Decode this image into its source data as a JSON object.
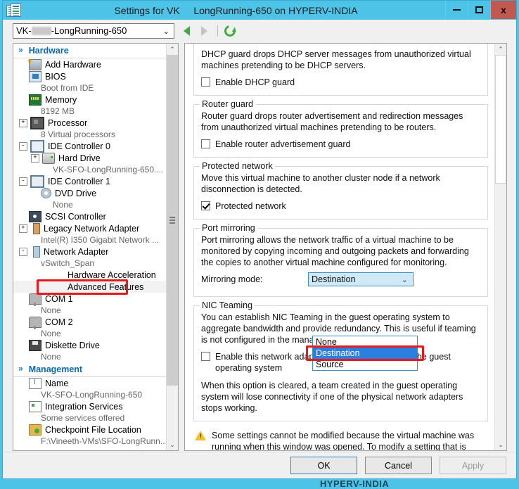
{
  "window": {
    "title_part1": "Settings for VK",
    "title_part2": "LongRunning-650 on HYPERV-INDIA",
    "icon": "settings-document-icon",
    "minimize_label": "",
    "maximize_label": "",
    "close_label": "x",
    "accent_color": "#4ec3e8",
    "close_color": "#c2584f"
  },
  "background": {
    "watermark": "HYPERV-INDIA"
  },
  "toolbar": {
    "vm_select_prefix": "VK-",
    "vm_select_suffix": "-LongRunning-650",
    "vm_select_caret": "⌄",
    "back_icon": "back-arrow-icon",
    "forward_icon": "forward-arrow-icon",
    "refresh_icon": "refresh-icon"
  },
  "sidebar": {
    "groups": [
      {
        "title": "Hardware",
        "chevron": "«",
        "items": [
          {
            "label": "Add Hardware",
            "sub": "",
            "expander": "",
            "icon": "add-hardware-icon",
            "indent": 0
          },
          {
            "label": "BIOS",
            "sub": "Boot from IDE",
            "expander": "",
            "icon": "bios-icon",
            "indent": 0
          },
          {
            "label": "Memory",
            "sub": "8192 MB",
            "expander": "",
            "icon": "memory-icon",
            "indent": 0
          },
          {
            "label": "Processor",
            "sub": "8 Virtual processors",
            "expander": "+",
            "icon": "processor-icon",
            "indent": 0
          },
          {
            "label": "IDE Controller 0",
            "sub": "",
            "expander": "-",
            "icon": "ide-controller-icon",
            "indent": 0
          },
          {
            "label": "Hard Drive",
            "sub": "VK-SFO-LongRunning-650....",
            "expander": "+",
            "icon": "hard-drive-icon",
            "indent": 1
          },
          {
            "label": "IDE Controller 1",
            "sub": "",
            "expander": "-",
            "icon": "ide-controller-icon",
            "indent": 0
          },
          {
            "label": "DVD Drive",
            "sub": "None",
            "expander": "",
            "icon": "dvd-drive-icon",
            "indent": 1
          },
          {
            "label": "SCSI Controller",
            "sub": "",
            "expander": "",
            "icon": "scsi-controller-icon",
            "indent": 0
          },
          {
            "label": "Legacy Network Adapter",
            "sub": "Intel(R) I350 Gigabit Network ...",
            "expander": "+",
            "icon": "legacy-network-adapter-icon",
            "indent": 0
          },
          {
            "label": "Network Adapter",
            "sub": "vSwitch_Span",
            "expander": "-",
            "icon": "network-adapter-icon",
            "indent": 0
          },
          {
            "label": "Hardware Acceleration",
            "sub": "",
            "expander": "",
            "icon": "",
            "indent": 2
          },
          {
            "label": "Advanced Features",
            "sub": "",
            "expander": "",
            "icon": "",
            "indent": 2,
            "selected": true,
            "annotated": true
          },
          {
            "label": "COM 1",
            "sub": "None",
            "expander": "",
            "icon": "com-port-icon",
            "indent": 0
          },
          {
            "label": "COM 2",
            "sub": "None",
            "expander": "",
            "icon": "com-port-icon",
            "indent": 0
          },
          {
            "label": "Diskette Drive",
            "sub": "None",
            "expander": "",
            "icon": "diskette-drive-icon",
            "indent": 0
          }
        ]
      },
      {
        "title": "Management",
        "chevron": "«",
        "items": [
          {
            "label": "Name",
            "sub": "VK-SFO-LongRunning-650",
            "expander": "",
            "icon": "name-icon",
            "indent": 0
          },
          {
            "label": "Integration Services",
            "sub": "Some services offered",
            "expander": "",
            "icon": "integration-services-icon",
            "indent": 0
          },
          {
            "label": "Checkpoint File Location",
            "sub": "F:\\Vineeth-VMs\\SFO-LongRunn...",
            "expander": "",
            "icon": "checkpoint-folder-icon",
            "indent": 0
          }
        ]
      }
    ],
    "scroll_up": "⌃",
    "scroll_down": "⌄"
  },
  "content": {
    "dhcp_guard": {
      "description": "DHCP guard drops DHCP server messages from unauthorized virtual machines pretending to be DHCP servers.",
      "checkbox_label": "Enable DHCP guard",
      "checked": false
    },
    "router_guard": {
      "legend": "Router guard",
      "description": "Router guard drops router advertisement and redirection messages from unauthorized virtual machines pretending to be routers.",
      "checkbox_label": "Enable router advertisement guard",
      "checked": false
    },
    "protected_network": {
      "legend": "Protected network",
      "description": "Move this virtual machine to another cluster node if a network disconnection is detected.",
      "checkbox_label": "Protected network",
      "checked": true
    },
    "port_mirroring": {
      "legend": "Port mirroring",
      "description": "Port mirroring allows the network traffic of a virtual machine to be monitored by copying incoming and outgoing packets and forwarding the copies to another virtual machine configured for monitoring.",
      "field_label": "Mirroring mode:",
      "selected_value": "Destination",
      "caret": "⌄",
      "options": [
        "None",
        "Destination",
        "Source"
      ],
      "highlighted_option": "Destination"
    },
    "nic_teaming": {
      "legend": "NIC Teaming",
      "description": "You can establish NIC Teaming in the guest operating system to aggregate bandwidth and provide redundancy. This is useful if teaming is not configured in the management operating system.",
      "checkbox_label": "Enable this network adapter to be part of a team in the guest operating system",
      "checked": false,
      "note": "When this option is cleared, a team created in the guest operating system will lose connectivity if one of the physical network adapters stops working."
    },
    "warning": {
      "icon": "warning-triangle-icon",
      "text": "Some settings cannot be modified because the virtual machine was running when this window was opened. To modify a setting that is unavailable, shut down the virtual machine and then reopen this window."
    },
    "scroll_up": "⌃",
    "scroll_down": "⌄"
  },
  "buttons": {
    "ok": "OK",
    "cancel": "Cancel",
    "apply": "Apply",
    "apply_disabled": true
  },
  "annotation": {
    "color": "#e8191a"
  }
}
